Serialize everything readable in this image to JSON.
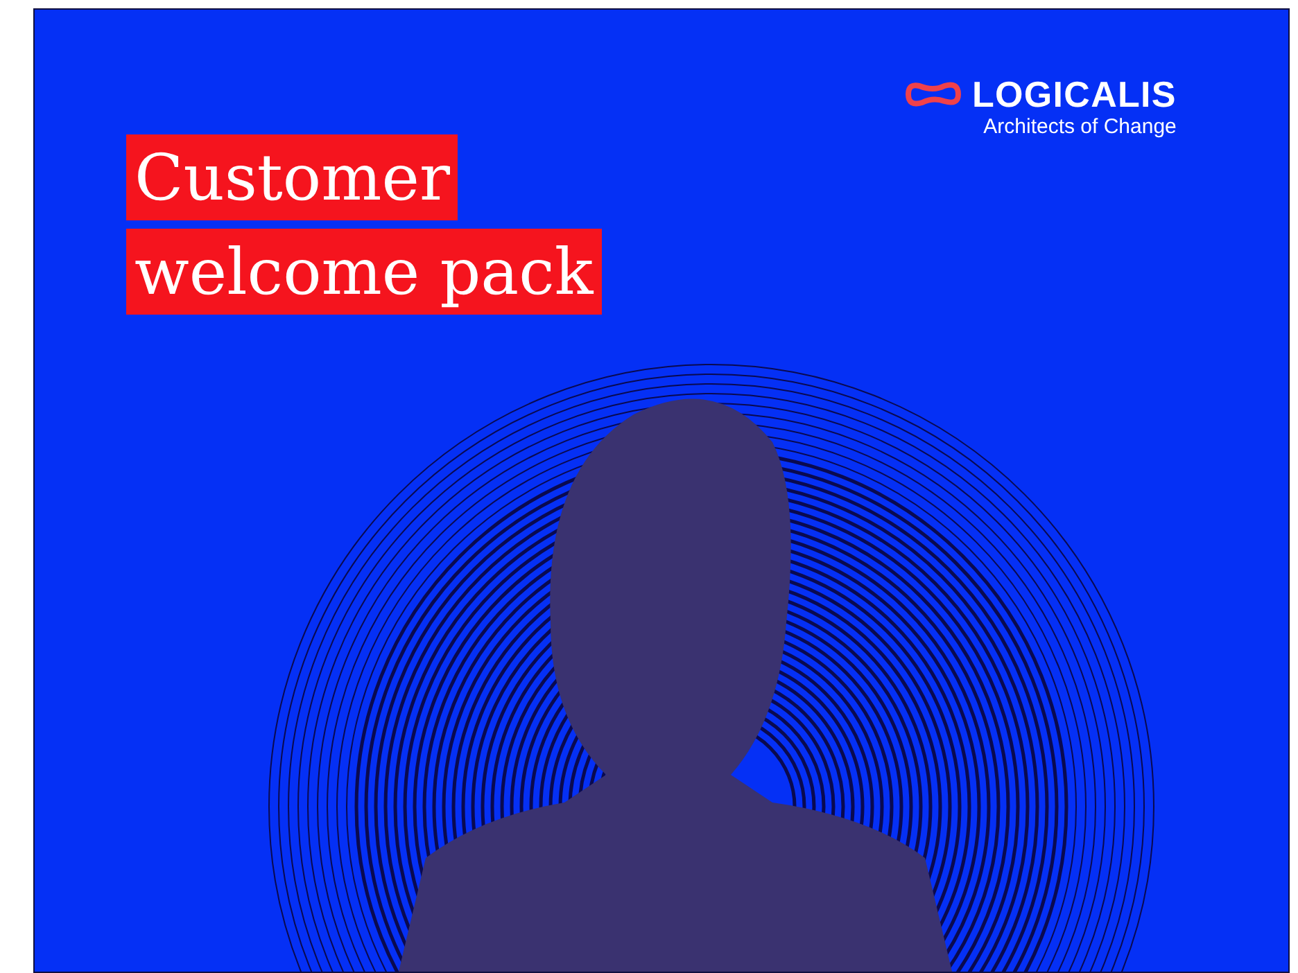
{
  "title_lines": [
    "Customer",
    "welcome pack"
  ],
  "logo": {
    "name": "LOGICALIS",
    "tagline": "Architects of Change"
  }
}
